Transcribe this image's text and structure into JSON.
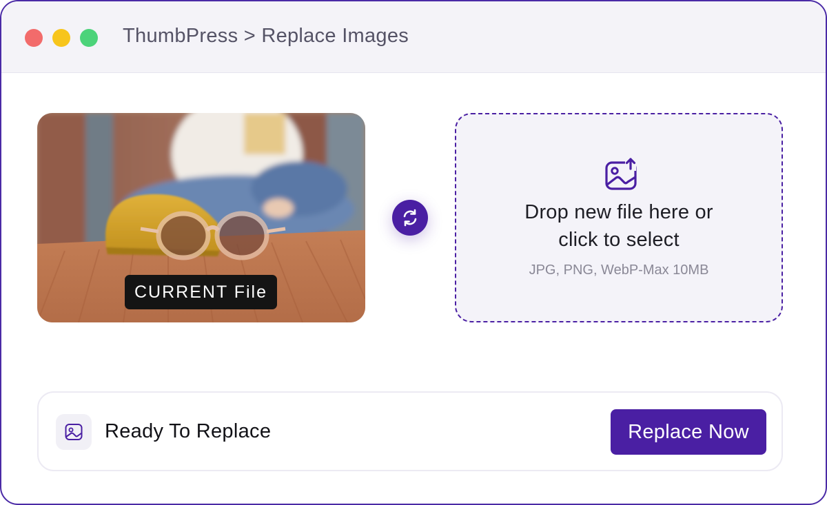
{
  "window": {
    "title": "ThumbPress > Replace Images",
    "controls": [
      "close",
      "minimize",
      "maximize"
    ]
  },
  "current_image": {
    "badge_label": "CURRENT File",
    "icon": "photo-of-sunglasses-on-case"
  },
  "swap": {
    "icon": "swap-arrows-icon"
  },
  "dropzone": {
    "icon": "image-upload-icon",
    "line1": "Drop new file here or",
    "line2": "click to select",
    "hint": "JPG, PNG, WebP-Max 10MB"
  },
  "status_bar": {
    "icon": "image-icon",
    "label": "Ready To Replace",
    "button_label": "Replace Now"
  },
  "colors": {
    "accent": "#4a1fa3",
    "window_border": "#4a2aa6",
    "titlebar_bg": "#f4f3f8",
    "dropzone_bg": "#f4f3f9",
    "close_dot": "#f26b6b",
    "minimize_dot": "#f7c51c",
    "maximize_dot": "#4cd37a"
  }
}
